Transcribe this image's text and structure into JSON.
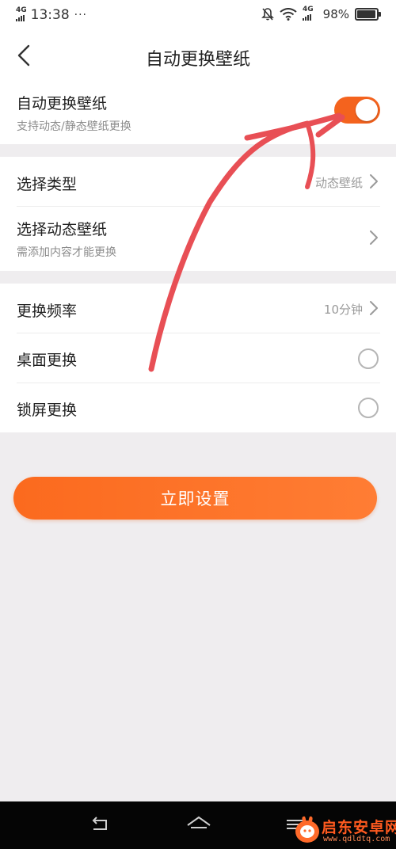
{
  "status_bar": {
    "network_left": "4G",
    "time": "13:38",
    "more_indicator": "···",
    "network_right": "4G",
    "battery": "98%",
    "battery_level": 0.98,
    "icons": [
      "mute-bell-icon",
      "wifi-icon",
      "battery-icon"
    ]
  },
  "header": {
    "title": "自动更换壁纸",
    "back_icon": "chevron-left-icon"
  },
  "auto_change": {
    "title": "自动更换壁纸",
    "subtitle": "支持动态/静态壁纸更换",
    "enabled": true
  },
  "wallpaper": {
    "type_label": "选择类型",
    "type_value": "动态壁纸",
    "dynamic_label": "选择动态壁纸",
    "dynamic_hint": "需添加内容才能更换"
  },
  "schedule": {
    "frequency_label": "更换频率",
    "frequency_value": "10分钟",
    "desktop_label": "桌面更换",
    "desktop_checked": false,
    "lockscreen_label": "锁屏更换",
    "lockscreen_checked": false
  },
  "actions": {
    "apply_label": "立即设置"
  },
  "watermark": {
    "title": "启东安卓网",
    "url": "www.qdldtq.com"
  },
  "colors": {
    "accent": "#f4631e",
    "background": "#efedef",
    "annotation_red": "#e84f55"
  }
}
